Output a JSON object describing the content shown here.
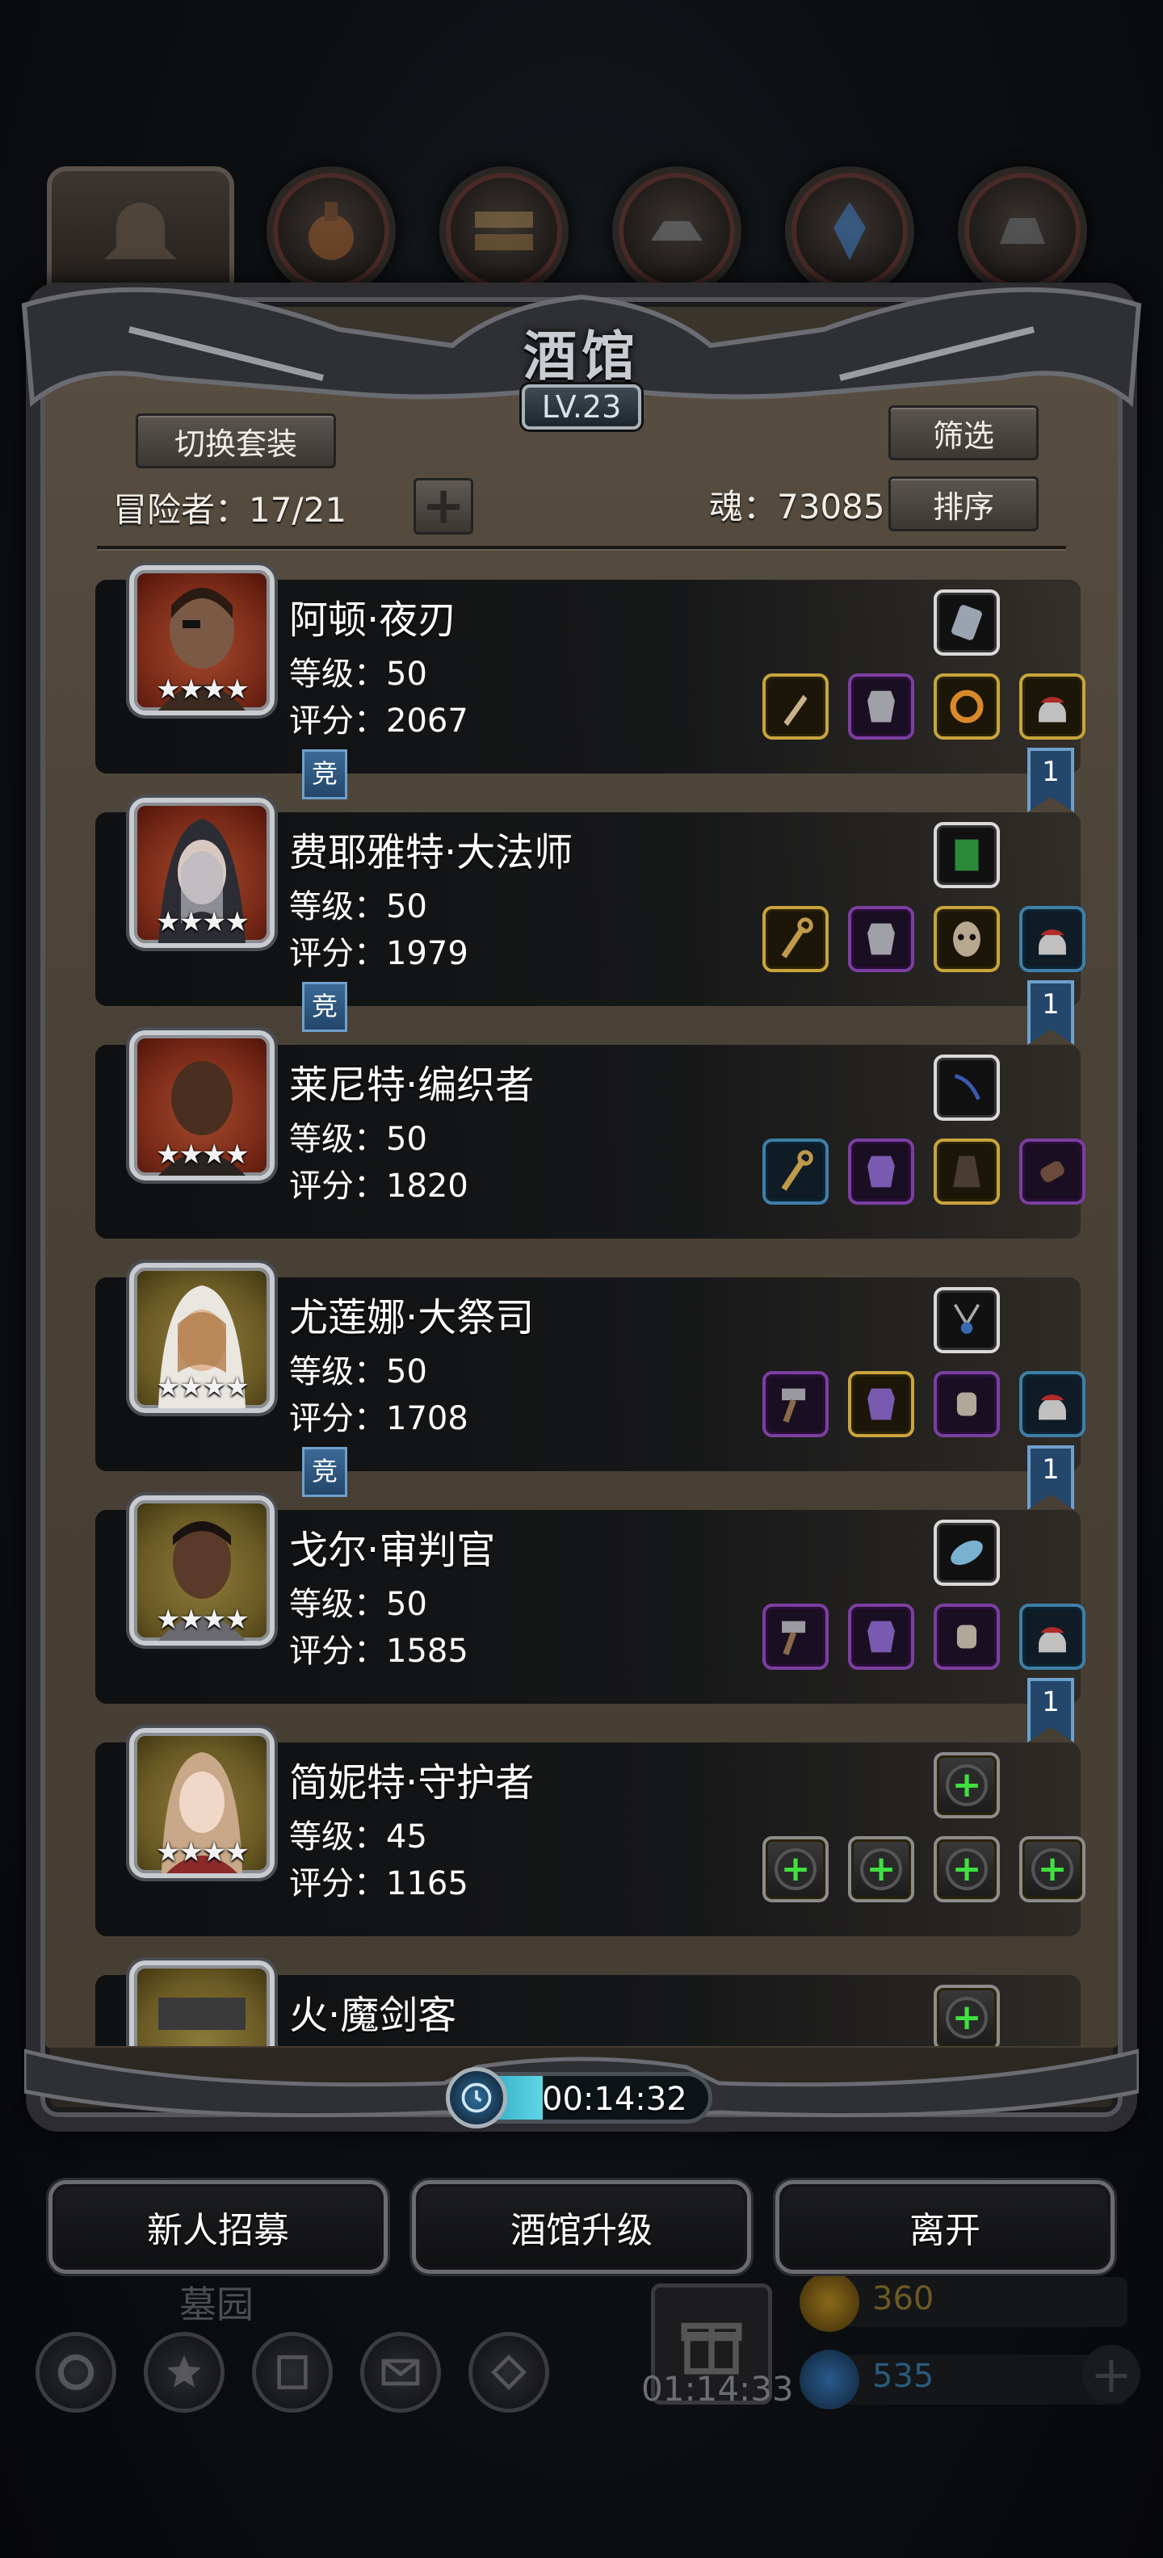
{
  "title": "酒馆",
  "level": "LV.23",
  "header": {
    "switch_outfit_label": "切换套装",
    "filter_label": "筛选",
    "sort_label": "排序",
    "adventurers_label": "冒险者：17/21",
    "soul_label": "魂：73085",
    "add_icon": "plus"
  },
  "stars": "★★★★",
  "adventurers": [
    {
      "name": "阿顿·夜刃",
      "level": "等级：50",
      "score": "评分：2067",
      "arena": "竞",
      "ribbon": "1"
    },
    {
      "name": "费耶雅特·大法师",
      "level": "等级：50",
      "score": "评分：1979",
      "arena": "竞",
      "ribbon": "1"
    },
    {
      "name": "莱尼特·编织者",
      "level": "等级：50",
      "score": "评分：1820"
    },
    {
      "name": "尤莲娜·大祭司",
      "level": "等级：50",
      "score": "评分：1708",
      "arena": "竞",
      "ribbon": "1"
    },
    {
      "name": "戈尔·审判官",
      "level": "等级：50",
      "score": "评分：1585",
      "ribbon": "1"
    },
    {
      "name": "简妮特·守护者",
      "level": "等级：45",
      "score": "评分：1165"
    },
    {
      "name": "火·魔剑客"
    }
  ],
  "timer": {
    "value": "00:14:32",
    "progress": 0.35
  },
  "actions": {
    "recruit": "新人招募",
    "upgrade": "酒馆升级",
    "leave": "离开"
  },
  "underlay": {
    "location": "墓园",
    "gift_timer": "01:14:33",
    "gold": "360",
    "gems": "535"
  },
  "colors": {
    "gold_rarity": "#c8a43c",
    "purple_rarity": "#7b3fa0",
    "blue_rarity": "#3f7fa8",
    "timer_fill": "#2fb5d0",
    "empty_plus": "#3fe03f"
  }
}
